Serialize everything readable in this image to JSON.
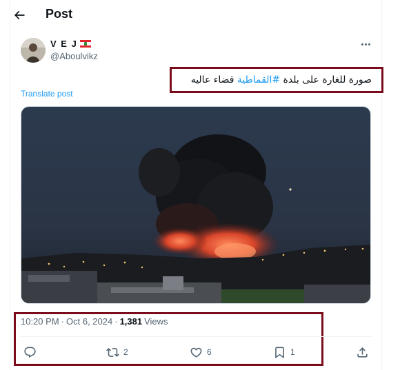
{
  "header": {
    "title": "Post",
    "back_icon": "arrow-left-icon"
  },
  "author": {
    "name": "V E J",
    "flag": "lebanon-flag-icon",
    "handle": "@Aboulvikz"
  },
  "tweet": {
    "text_before": "صورة للغارة على بلدة ",
    "hashtag": "#القماطية",
    "text_after": " قضاء عاليه",
    "translate_label": "Translate post"
  },
  "meta": {
    "time": "10:20 PM",
    "separator": "·",
    "date": "Oct 6, 2024",
    "views_count": "1,381",
    "views_label": "Views"
  },
  "actions": {
    "reply_count": "",
    "repost_count": "2",
    "like_count": "6",
    "bookmark_count": "1"
  },
  "colors": {
    "accent": "#1d9bf0",
    "highlight_border": "#7a0c1c",
    "muted": "#536471"
  }
}
